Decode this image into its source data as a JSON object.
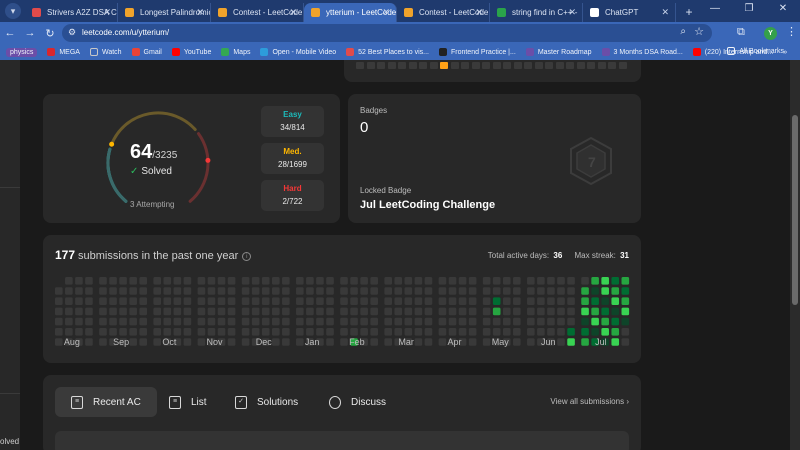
{
  "browser": {
    "tabs": [
      {
        "title": "Strivers A2Z DSA Co",
        "color": "#e14b4b"
      },
      {
        "title": "Longest Palindromic",
        "color": "#f0a32b"
      },
      {
        "title": "Contest - LeetCode",
        "color": "#f0a32b"
      },
      {
        "title": "ytterium - LeetCode",
        "color": "#f0a32b",
        "active": true
      },
      {
        "title": "Contest - LeetCode",
        "color": "#f0a32b"
      },
      {
        "title": "string find in C++ -",
        "color": "#2aa34a"
      },
      {
        "title": "ChatGPT",
        "color": "#ffffff"
      }
    ],
    "new_tab": "+",
    "url": "leetcode.com/u/ytterium/",
    "profile_initial": "Y",
    "bookmarks": [
      {
        "label": "physics",
        "color": "#6b4ea8"
      },
      {
        "label": "MEGA",
        "color": "#d9272e"
      },
      {
        "label": "Watch",
        "color": "#c8c8c8"
      },
      {
        "label": "Gmail",
        "color": "#ea4335"
      },
      {
        "label": "YouTube",
        "color": "#ff0000"
      },
      {
        "label": "Maps",
        "color": "#34a853"
      },
      {
        "label": "Open - Mobile Video",
        "color": "#2d9cdb"
      },
      {
        "label": "52 Best Places to vis...",
        "color": "#e14b4b"
      },
      {
        "label": "Frontend Practice |...",
        "color": "#222222"
      },
      {
        "label": "Master Roadmap",
        "color": "#6b4ea8"
      },
      {
        "label": "3 Months DSA Road...",
        "color": "#6b4ea8"
      },
      {
        "label": "(220) Internship and...",
        "color": "#ff0000"
      }
    ],
    "more_bookmarks": "»",
    "all_bookmarks": "All Bookmarks"
  },
  "sidebar": {
    "solved_text": "olved"
  },
  "solved": {
    "solved_count": "64",
    "total": "/3235",
    "solved_label": "Solved",
    "attempting": "3 Attempting",
    "progress_fraction": 0.0198,
    "difficulties": [
      {
        "name": "Easy",
        "value": "34/814",
        "color": "#1cbaba"
      },
      {
        "name": "Med.",
        "value": "28/1699",
        "color": "#ffb700"
      },
      {
        "name": "Hard",
        "value": "2/722",
        "color": "#f63737"
      }
    ]
  },
  "badges": {
    "label": "Badges",
    "count": "0",
    "locked_label": "Locked Badge",
    "locked_name": "Jul LeetCoding Challenge"
  },
  "submissions": {
    "count": "177",
    "title": "submissions in the past one year",
    "total_active_label": "Total active days:",
    "total_active_value": "36",
    "max_streak_label": "Max streak:",
    "max_streak_value": "31",
    "months": [
      "Aug",
      "Sep",
      "Oct",
      "Nov",
      "Dec",
      "Jan",
      "Feb",
      "Mar",
      "Apr",
      "May",
      "Jun",
      "Jul"
    ]
  },
  "profile_tabs": {
    "tabs": [
      {
        "label": "Recent AC",
        "icon": "recent-ac-icon",
        "active": true
      },
      {
        "label": "List",
        "icon": "list-icon"
      },
      {
        "label": "Solutions",
        "icon": "solutions-icon"
      },
      {
        "label": "Discuss",
        "icon": "discuss-icon"
      }
    ],
    "view_all": "View all submissions"
  }
}
